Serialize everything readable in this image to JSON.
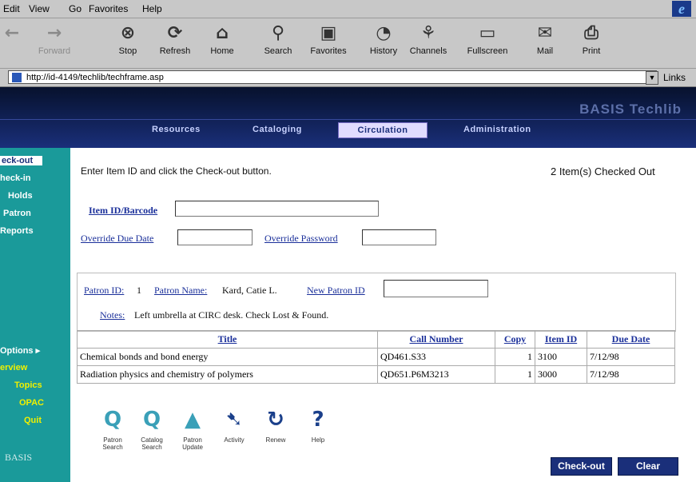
{
  "menu": [
    "Edit",
    "View",
    "Go",
    "Favorites",
    "Help"
  ],
  "toolbar": {
    "forward": "Forward",
    "stop": "Stop",
    "refresh": "Refresh",
    "home": "Home",
    "search": "Search",
    "favorites": "Favorites",
    "history": "History",
    "channels": "Channels",
    "fullscreen": "Fullscreen",
    "mail": "Mail",
    "print": "Print"
  },
  "address": {
    "url": "http://id-4149/techlib/techframe.asp",
    "links": "Links"
  },
  "brand": "BASIS Techlib",
  "tabs": [
    "Resources",
    "Cataloging",
    "Circulation",
    "Administration"
  ],
  "sidebar": {
    "items": [
      "eck-out",
      "heck-in",
      "Holds",
      "Patron",
      "Reports"
    ],
    "lower": [
      "Options ▸",
      "erview",
      "Topics",
      "OPAC",
      "Quit"
    ],
    "logo": "BASIS"
  },
  "form": {
    "instruction": "Enter Item ID and click the Check-out button.",
    "checked_out": "2  Item(s) Checked Out",
    "item_label": "Item ID/Barcode",
    "override_due": "Override Due Date",
    "override_pw": "Override Password"
  },
  "patron": {
    "id_label": "Patron ID:",
    "id_value": "1",
    "name_label": "Patron Name:",
    "name_value": "Kard, Catie L.",
    "new_label": "New Patron ID",
    "notes_label": "Notes:",
    "notes_value": "Left umbrella at CIRC desk. Check Lost & Found."
  },
  "table": {
    "headers": [
      "Title",
      "Call Number",
      "Copy",
      "Item ID",
      "Due Date"
    ],
    "rows": [
      [
        "Chemical bonds and bond energy",
        "QD461.S33",
        "1",
        "3100",
        "7/12/98"
      ],
      [
        "Radiation physics and chemistry of polymers",
        "QD651.P6M3213",
        "1",
        "3000",
        "7/12/98"
      ]
    ]
  },
  "bottom_icons": [
    "Patron Search",
    "Catalog Search",
    "Patron Update",
    "Activity",
    "Renew",
    "Help"
  ],
  "buttons": {
    "checkout": "Check-out",
    "clear": "Clear"
  },
  "colors": {
    "nav_dark": "#0c1a44",
    "sidebar": "#1a9a9a",
    "link": "#1a2f9a",
    "button": "#1a2f7a"
  }
}
